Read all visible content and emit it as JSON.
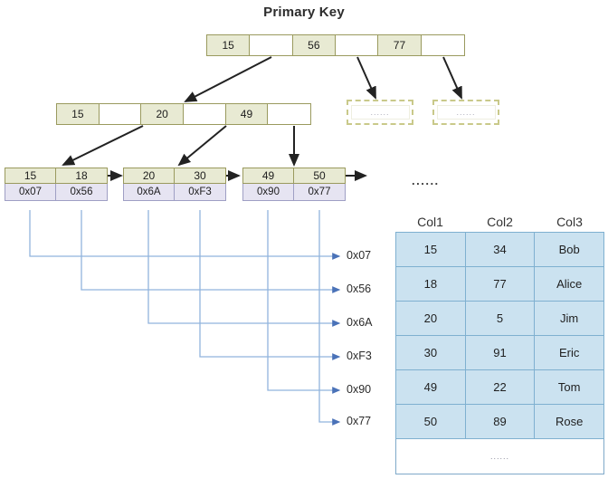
{
  "title": "Primary Key",
  "btree": {
    "root": {
      "cells": [
        "15",
        "",
        "56",
        "",
        "77",
        ""
      ]
    },
    "level2": {
      "cells": [
        "15",
        "",
        "20",
        "",
        "49",
        ""
      ]
    },
    "leaves": [
      {
        "keys": [
          "15",
          "18"
        ],
        "pointers": [
          "0x07",
          "0x56"
        ]
      },
      {
        "keys": [
          "20",
          "30"
        ],
        "pointers": [
          "0x6A",
          "0xF3"
        ]
      },
      {
        "keys": [
          "49",
          "50"
        ],
        "pointers": [
          "0x90",
          "0x77"
        ]
      }
    ],
    "placeholders": [
      {
        "label": "......"
      },
      {
        "label": "......"
      }
    ]
  },
  "offset_labels": [
    "0x07",
    "0x56",
    "0x6A",
    "0xF3",
    "0x90",
    "0x77"
  ],
  "table": {
    "ellipsis_above": "......",
    "headers": [
      "Col1",
      "Col2",
      "Col3"
    ],
    "rows": [
      [
        "15",
        "34",
        "Bob"
      ],
      [
        "18",
        "77",
        "Alice"
      ],
      [
        "20",
        "5",
        "Jim"
      ],
      [
        "30",
        "91",
        "Eric"
      ],
      [
        "49",
        "22",
        "Tom"
      ],
      [
        "50",
        "89",
        "Rose"
      ]
    ],
    "more_row": "......"
  },
  "colors": {
    "node_fill": "#e8ead3",
    "node_border": "#9a9a5e",
    "pointer_fill": "#e6e4f2",
    "pointer_border": "#9f9fc4",
    "table_fill": "#cbe2f0",
    "table_border": "#7fb0d0",
    "connector": "#91b4dd",
    "arrow": "#222222",
    "dashed_box": "#c9c98a"
  }
}
